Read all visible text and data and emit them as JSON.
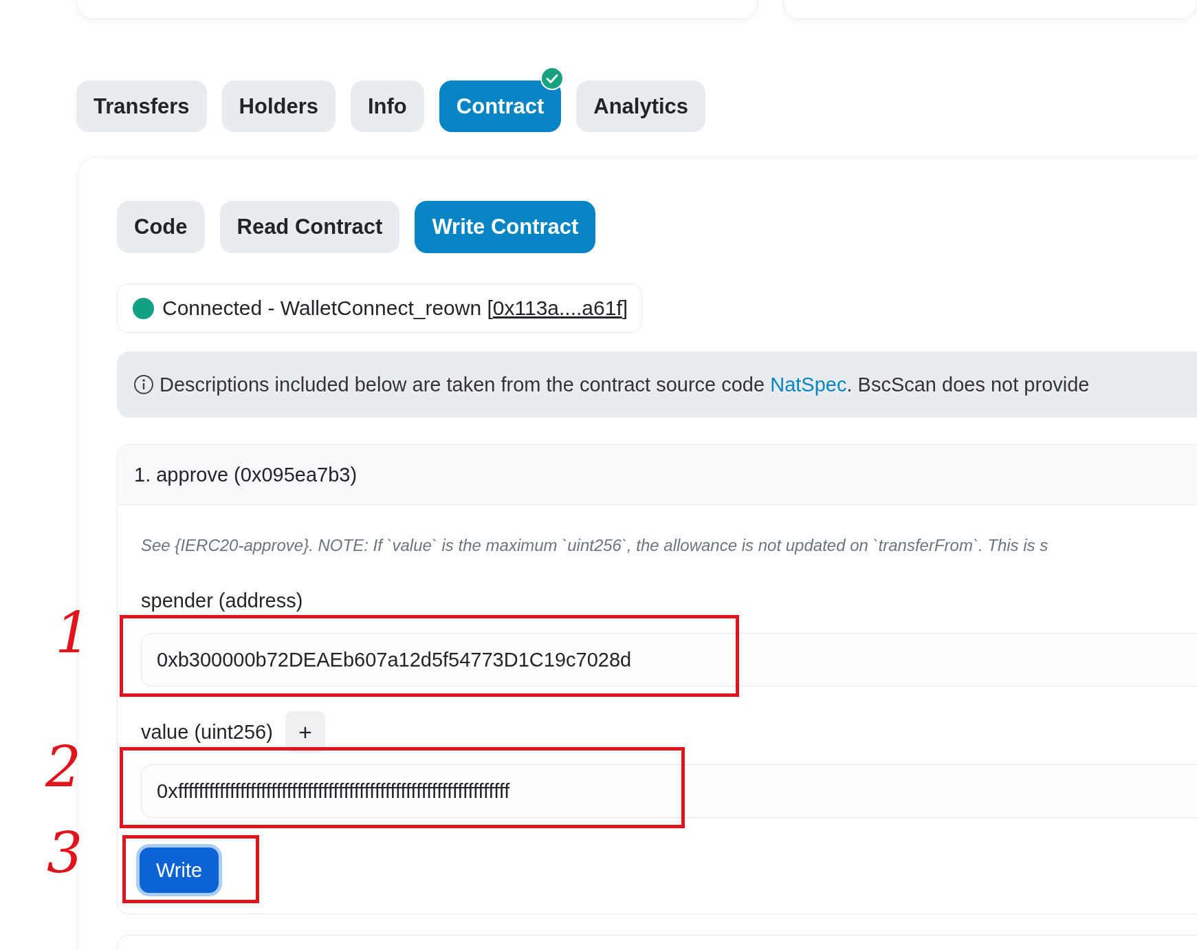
{
  "tabs": [
    {
      "label": "Transfers",
      "selected": false,
      "verified": false
    },
    {
      "label": "Holders",
      "selected": false,
      "verified": false
    },
    {
      "label": "Info",
      "selected": false,
      "verified": false
    },
    {
      "label": "Contract",
      "selected": true,
      "verified": true
    },
    {
      "label": "Analytics",
      "selected": false,
      "verified": false
    }
  ],
  "subtabs": [
    {
      "label": "Code",
      "selected": false
    },
    {
      "label": "Read Contract",
      "selected": false
    },
    {
      "label": "Write Contract",
      "selected": true
    }
  ],
  "connection": {
    "status": "Connected - WalletConnect_reown [",
    "address": "0x113a....a61f",
    "suffix": "]"
  },
  "notice": {
    "text": "Descriptions included below are taken from the contract source code ",
    "link": "NatSpec",
    "after": ". BscScan does not provide"
  },
  "functions": [
    {
      "title": "1. approve (0x095ea7b3)",
      "description": "See {IERC20-approve}. NOTE: If `value` is the maximum `uint256`, the allowance is not updated on `transferFrom`. This is s",
      "inputs": [
        {
          "label": "spender (address)",
          "value": "0xb300000b72DEAEb607a12d5f54773D1C19c7028d",
          "expandable": false
        },
        {
          "label": "value (uint256)",
          "value": "0xffffffffffffffffffffffffffffffffffffffffffffffffffffffffffffffff",
          "expandable": true,
          "expand_label": "+"
        }
      ],
      "button": "Write"
    }
  ],
  "annotations": [
    {
      "label": "1"
    },
    {
      "label": "2"
    },
    {
      "label": "3"
    }
  ]
}
